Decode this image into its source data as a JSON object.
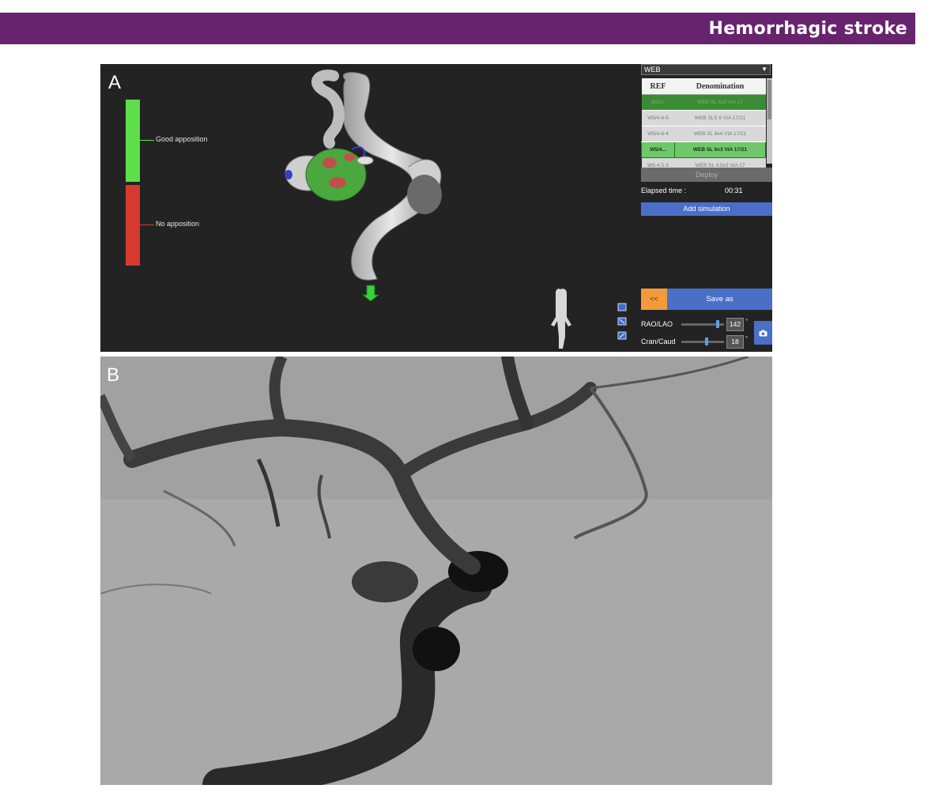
{
  "header": {
    "title": "Hemorrhagic stroke"
  },
  "panel_a": {
    "letter": "A",
    "legend": {
      "good_label": "Good apposition",
      "no_label": "No apposition"
    },
    "sidebar": {
      "dropdown_value": "WEB",
      "table": {
        "headers": [
          "REF",
          "Denomination"
        ],
        "rows": [
          [
            "W5/3-",
            "WEB SL 5x3 VIA 17"
          ],
          [
            "W5/4-6-5",
            "WEB SLS 6 VIA 17/21"
          ],
          [
            "W5/4-6-4",
            "WEB SL 6x4 VIA 17/21"
          ],
          [
            "W5/4...",
            "WEB SL 6x3 VIA 17/21"
          ],
          [
            "W5-4.5-3",
            "WEB SL 4.5x3 VIA 17"
          ]
        ]
      },
      "deploy_label": "Deploy",
      "elapsed_label": "Elapsed time :",
      "elapsed_value": "00:31",
      "add_simulation_label": "Add simulation",
      "back_label": "<<",
      "save_as_label": "Save as",
      "rao_lao_label": "RAO/LAO",
      "rao_lao_value": "142",
      "cran_caud_label": "Cran/Caud",
      "cran_caud_value": "18",
      "degree_symbol": "°"
    }
  },
  "panel_b": {
    "letter": "B"
  },
  "colors": {
    "header_bg": "#68236f",
    "good_apposition": "#5ede4a",
    "no_apposition": "#d63a2e",
    "selected_row": "#6ec86a",
    "button_blue": "#4a6fc9",
    "button_orange": "#f39a3c"
  }
}
